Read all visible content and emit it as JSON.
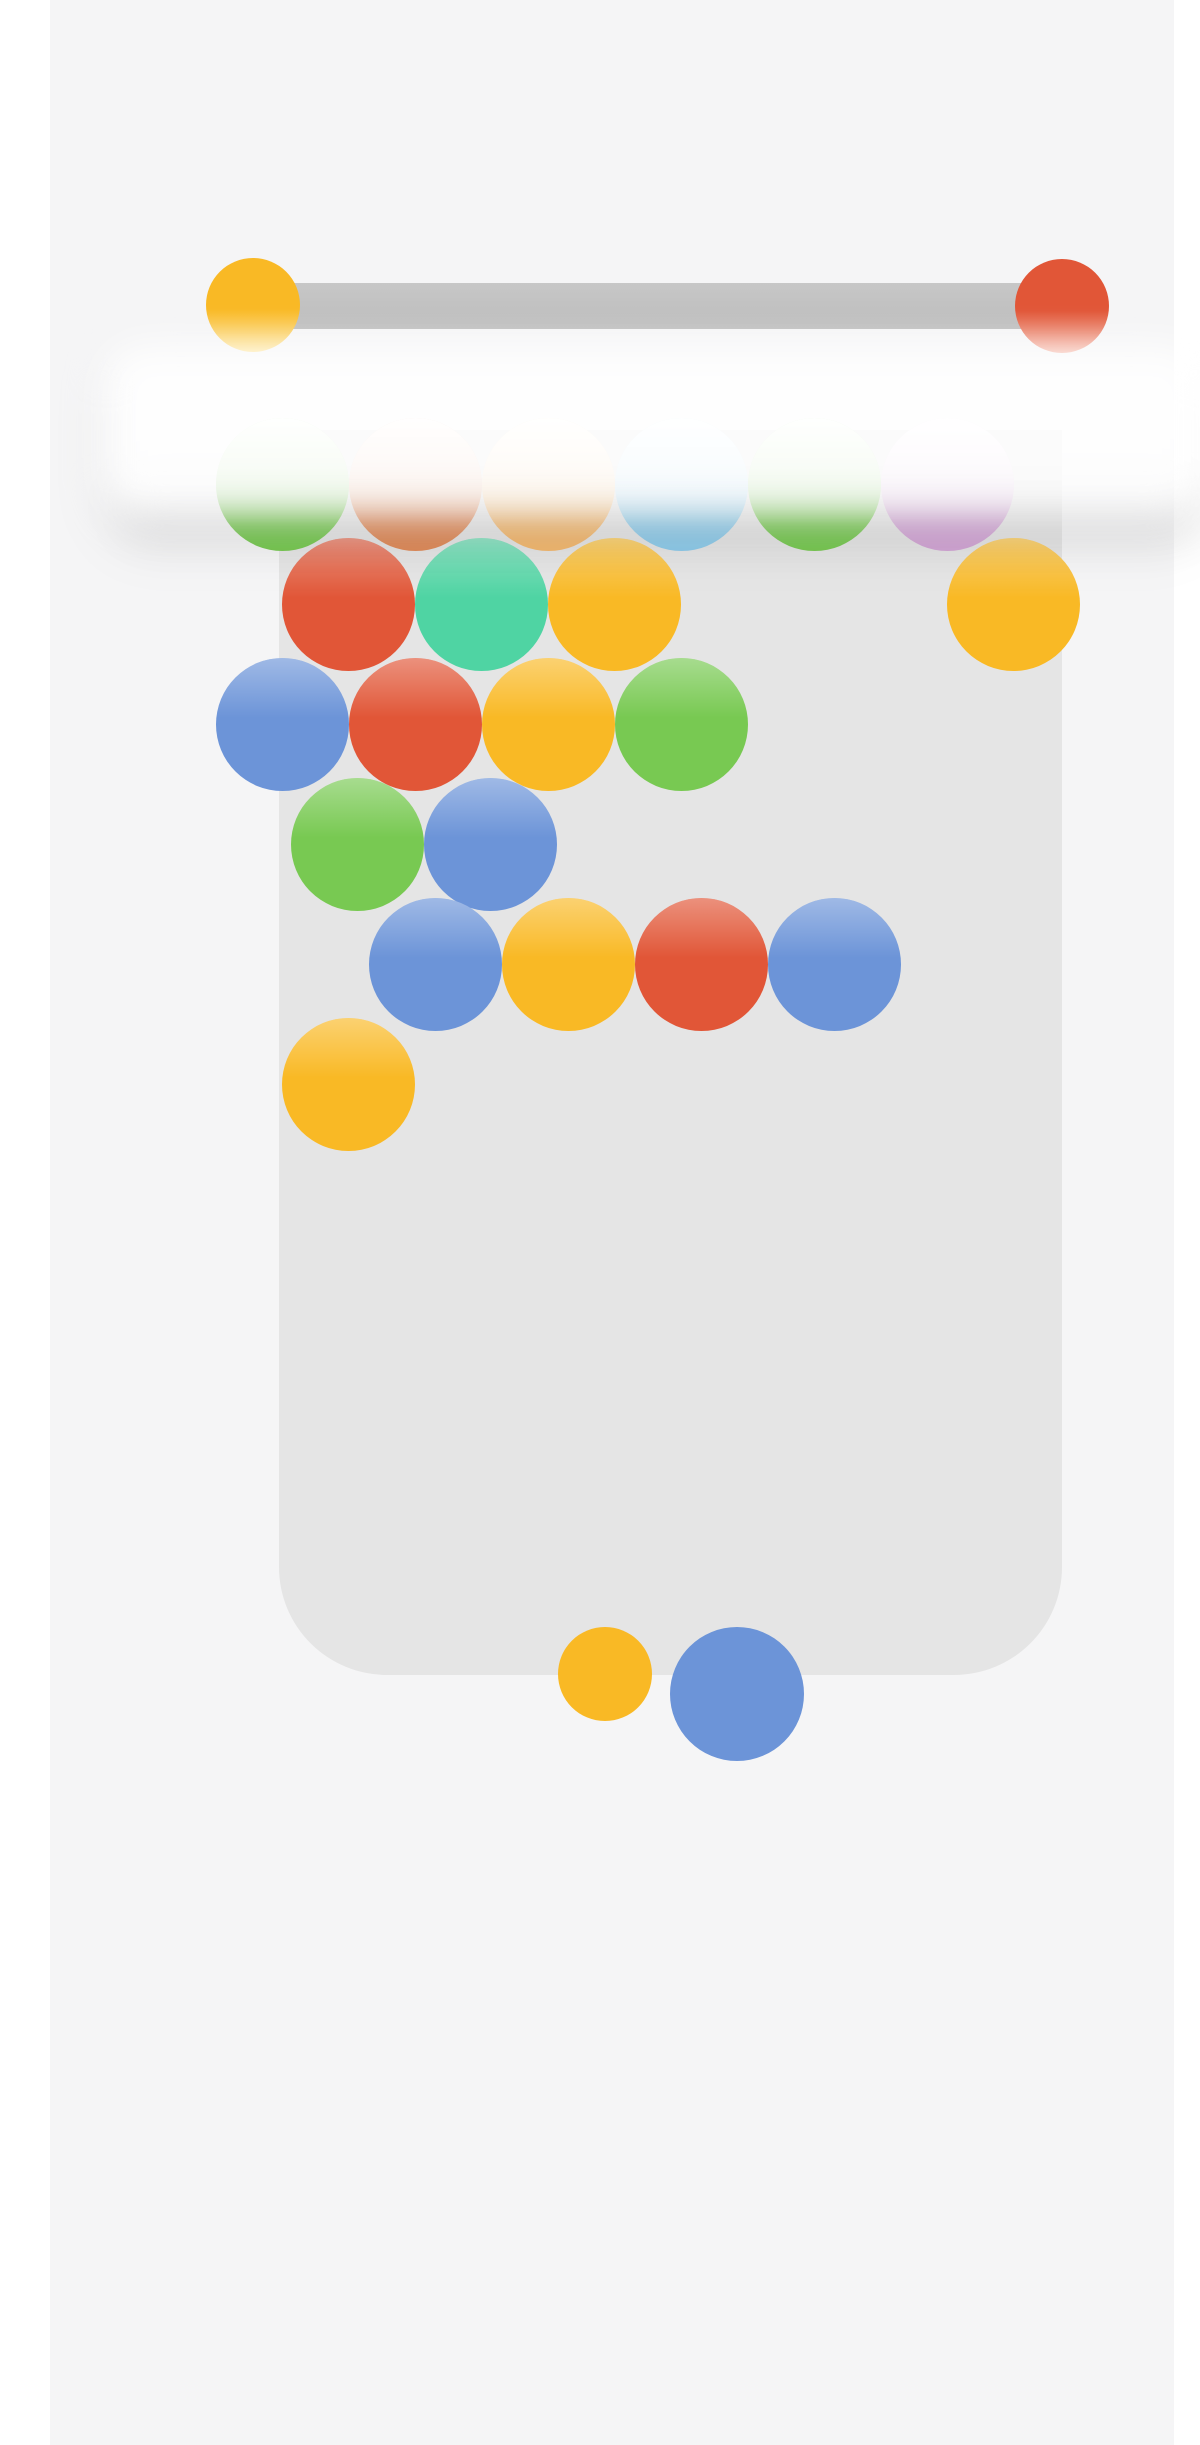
{
  "colors": {
    "yellow": "#f9b925",
    "red": "#e15637",
    "green": "#78c952",
    "blue": "#6c94d8",
    "teal": "#4fd4a3",
    "orange": "#e08b5a",
    "sky": "#8ecbea",
    "purple": "#d3a6d6",
    "peach": "#f3b86f",
    "board": "#e5e5e5",
    "background": "#f5f5f6"
  },
  "progress": {
    "start_color": "yellow",
    "goal_color": "red",
    "fill_fraction": 0.0
  },
  "top_row": [
    {
      "color": "green"
    },
    {
      "color": "orange"
    },
    {
      "color": "peach"
    },
    {
      "color": "sky"
    },
    {
      "color": "green"
    },
    {
      "color": "purple"
    }
  ],
  "grid_rows": [
    {
      "row": 1,
      "offset": true,
      "cells": [
        {
          "col": 0,
          "color": "red"
        },
        {
          "col": 1,
          "color": "teal"
        },
        {
          "col": 2,
          "color": "yellow"
        },
        {
          "col": 5,
          "color": "yellow"
        }
      ]
    },
    {
      "row": 2,
      "offset": false,
      "cells": [
        {
          "col": 0,
          "color": "blue"
        },
        {
          "col": 1,
          "color": "red"
        },
        {
          "col": 2,
          "color": "yellow"
        },
        {
          "col": 3,
          "color": "green"
        }
      ]
    },
    {
      "row": 3,
      "offset": true,
      "cells": [
        {
          "col": 0,
          "color": "green"
        },
        {
          "col": 1,
          "color": "blue"
        }
      ]
    },
    {
      "row": 4,
      "offset": false,
      "cells": [
        {
          "col": 1,
          "color": "blue"
        },
        {
          "col": 2,
          "color": "yellow"
        },
        {
          "col": 3,
          "color": "red"
        },
        {
          "col": 4,
          "color": "blue"
        }
      ]
    },
    {
      "row": 5,
      "offset": true,
      "cells": [
        {
          "col": 0,
          "color": "yellow"
        }
      ]
    }
  ],
  "shooter": {
    "next_color": "yellow",
    "current_color": "blue"
  }
}
